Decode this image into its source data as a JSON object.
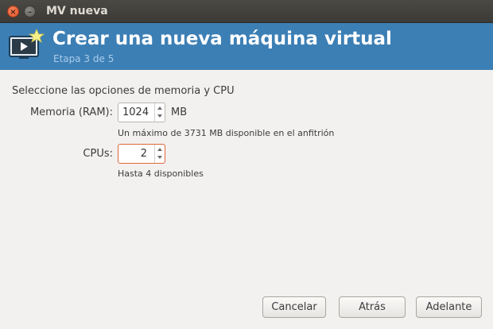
{
  "window": {
    "title": "MV nueva"
  },
  "header": {
    "title": "Crear una nueva máquina virtual",
    "step": "Etapa 3 de 5",
    "icon": "vm-new-icon"
  },
  "form": {
    "section_label": "Seleccione las opciones de memoria y CPU",
    "memory": {
      "label": "Memoria (RAM):",
      "value": "1024",
      "unit": "MB",
      "hint": "Un máximo de 3731 MB disponible en el anfitrión"
    },
    "cpus": {
      "label": "CPUs:",
      "value": "2",
      "hint": "Hasta 4 disponibles"
    }
  },
  "buttons": {
    "cancel": "Cancelar",
    "back": "Atrás",
    "forward": "Adelante"
  },
  "colors": {
    "header_bg": "#3c7fb5",
    "focus": "#e0673a"
  }
}
